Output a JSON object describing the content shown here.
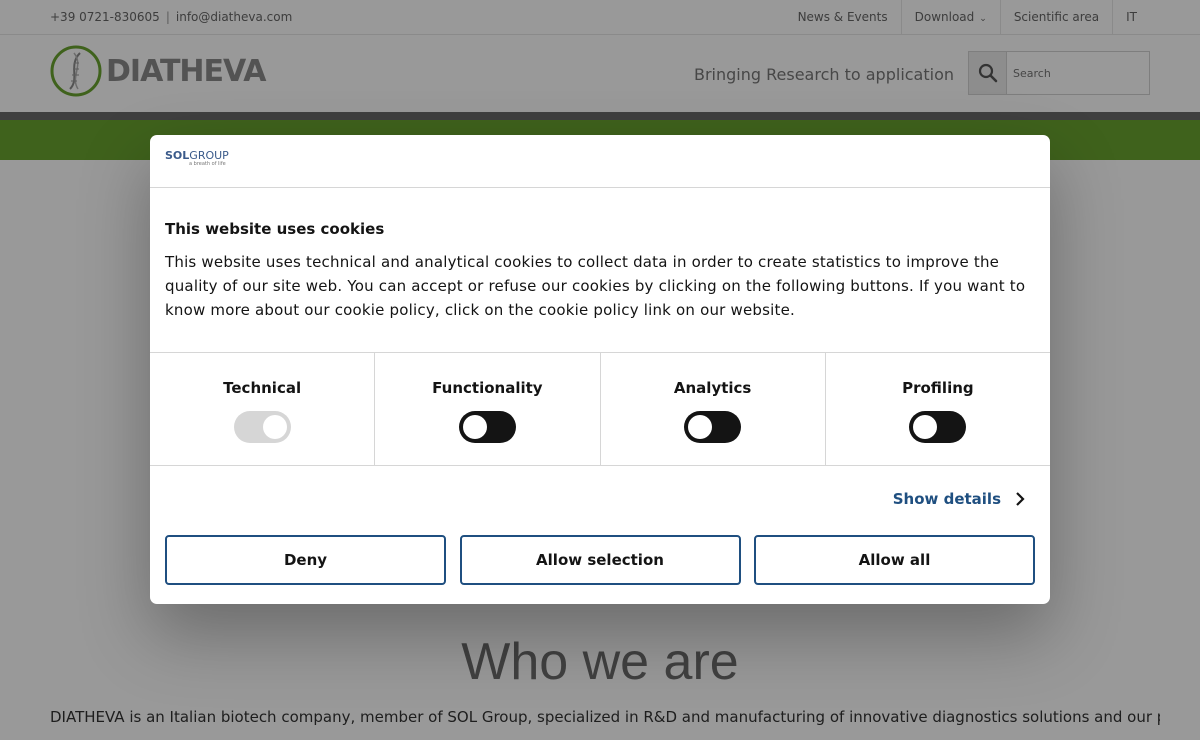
{
  "topbar": {
    "phone": "+39 0721-830605",
    "separator": "|",
    "email": "info@diatheva.com",
    "nav": [
      {
        "label": "News & Events"
      },
      {
        "label": "Download"
      },
      {
        "label": "Scientific area"
      },
      {
        "label": "IT"
      }
    ]
  },
  "header": {
    "logo_text": "DIATHEVA",
    "tagline": "Bringing Research to application",
    "search_placeholder": "Search",
    "search_icon": "search-icon"
  },
  "page": {
    "heading": "Who we are",
    "intro": "DIATHEVA is an Italian biotech company, member of SOL Group, specialized in R&D and manufacturing of innovative diagnostics solutions and our product portfolio"
  },
  "cookie_dialog": {
    "brand": {
      "name_bold": "SOL",
      "name_light": "GROUP",
      "tagline": "a breath of life"
    },
    "title": "This website uses cookies",
    "text": "This website uses technical and analytical cookies to collect data in order to create statistics to improve the quality of our site web. You can accept or refuse our cookies by clicking on the following buttons. If you want to know more about our cookie policy, click on the cookie policy link on our website.",
    "categories": [
      {
        "label": "Technical",
        "checked": true,
        "disabled": true
      },
      {
        "label": "Functionality",
        "checked": false,
        "disabled": false
      },
      {
        "label": "Analytics",
        "checked": false,
        "disabled": false
      },
      {
        "label": "Profiling",
        "checked": false,
        "disabled": false
      }
    ],
    "show_details": "Show details",
    "buttons": {
      "deny": "Deny",
      "allow_selection": "Allow selection",
      "allow_all": "Allow all"
    },
    "colors": {
      "accent": "#1f4f80",
      "toggle_on": "#141414",
      "toggle_disabled": "#d6d6d6"
    }
  },
  "colors": {
    "brand_green": "#6aa330",
    "header_gray": "#6a6a6a"
  }
}
